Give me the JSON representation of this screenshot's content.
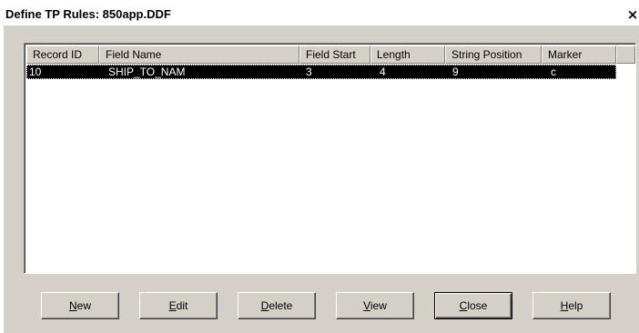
{
  "window": {
    "title": "Define TP Rules: 850app.DDF",
    "close_glyph": "×",
    "close_icon": "close-icon"
  },
  "list": {
    "columns": [
      "Record ID",
      "Field Name",
      "Field Start",
      "Length",
      "String Position",
      "Marker"
    ],
    "rows": [
      {
        "record_id": "10",
        "field_name": "SHIP_TO_NAM",
        "field_start": "3",
        "length": "4",
        "string_position": "9",
        "marker": "c",
        "selected": true
      }
    ]
  },
  "buttons": {
    "new": {
      "mnemonic": "N",
      "rest": "ew"
    },
    "edit": {
      "mnemonic": "E",
      "rest": "dit"
    },
    "delete": {
      "mnemonic": "D",
      "rest": "elete"
    },
    "view": {
      "mnemonic": "V",
      "rest": "iew"
    },
    "close": {
      "mnemonic": "C",
      "rest": "lose"
    },
    "help": {
      "mnemonic": "H",
      "rest": "elp"
    }
  }
}
